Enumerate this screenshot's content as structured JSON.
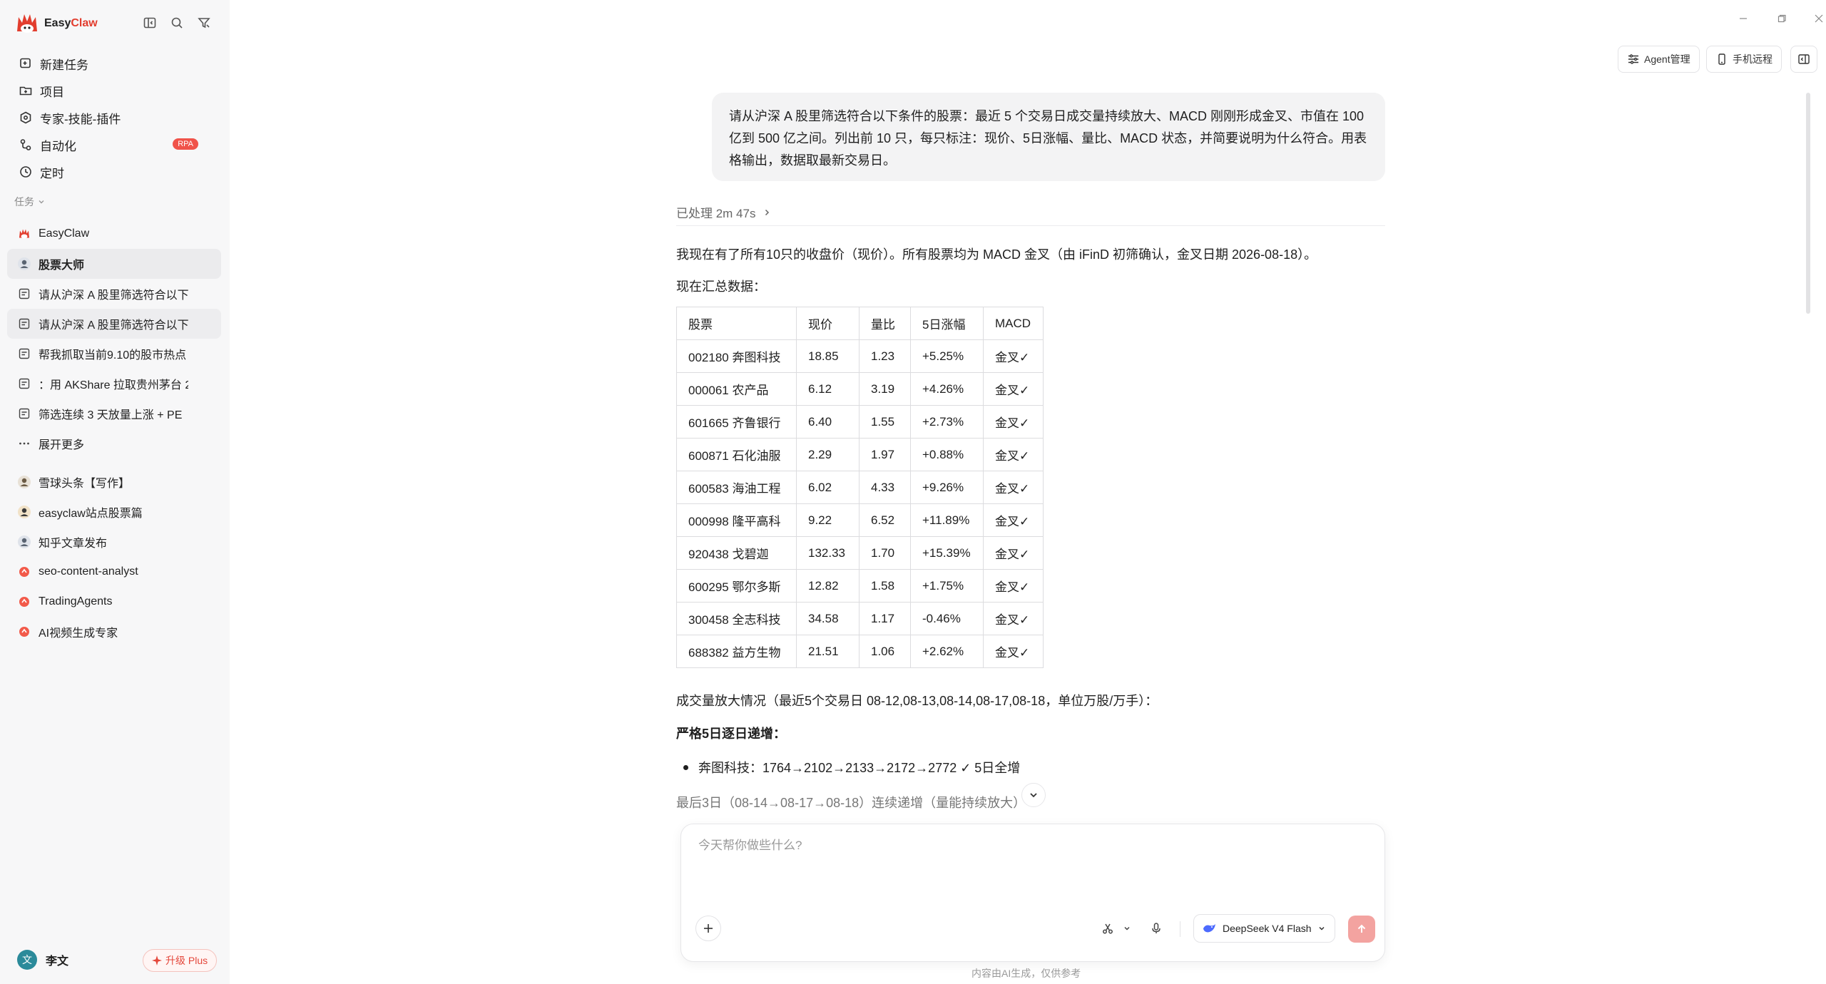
{
  "app": {
    "name_main": "Easy",
    "name_accent": "Claw"
  },
  "nav": [
    {
      "label": "新建任务",
      "icon": "new-task-icon"
    },
    {
      "label": "项目",
      "icon": "folder-icon"
    },
    {
      "label": "专家-技能-插件",
      "icon": "puzzle-icon"
    },
    {
      "label": "自动化",
      "icon": "automation-icon",
      "badge": "RPA"
    },
    {
      "label": "定时",
      "icon": "clock-icon"
    }
  ],
  "tasks_section_label": "任务",
  "tasks": [
    {
      "label": "EasyClaw",
      "icon": "easyclaw-logo-icon"
    },
    {
      "label": "股票大师",
      "icon": "avatar-icon",
      "active": true
    },
    {
      "label": "请从沪深 A 股里筛选符合以下",
      "icon": "chat-icon"
    },
    {
      "label": "请从沪深 A 股里筛选符合以下",
      "icon": "chat-icon",
      "hover": true
    },
    {
      "label": "帮我抓取当前9.10的股市热点",
      "icon": "chat-icon"
    },
    {
      "label": "：用 AKShare 拉取贵州茅台 2",
      "icon": "chat-icon"
    },
    {
      "label": "筛选连续 3 天放量上涨 + PE",
      "icon": "chat-icon"
    },
    {
      "label": "展开更多",
      "icon": "more-icon"
    }
  ],
  "agents": [
    {
      "label": "雪球头条【写作】",
      "icon": "avatar-icon"
    },
    {
      "label": "easyclaw站点股票篇",
      "icon": "avatar-icon"
    },
    {
      "label": "知乎文章发布",
      "icon": "avatar-icon"
    },
    {
      "label": "seo-content-analyst",
      "icon": "easyclaw-logo-icon"
    },
    {
      "label": "TradingAgents",
      "icon": "easyclaw-logo-icon"
    },
    {
      "label": "AI视频生成专家",
      "icon": "easyclaw-logo-icon"
    }
  ],
  "user": {
    "initial": "文",
    "name": "李文",
    "upgrade_label": "升级 Plus"
  },
  "header": {
    "agent_btn": "Agent管理",
    "phone_btn": "手机远程"
  },
  "chat": {
    "user_message": "请从沪深 A 股里筛选符合以下条件的股票：最近 5 个交易日成交量持续放大、MACD 刚刚形成金叉、市值在 100 亿到 500 亿之间。列出前 10 只，每只标注：现价、5日涨幅、量比、MACD 状态，并简要说明为什么符合。用表格输出，数据取最新交易日。",
    "processed": "已处理 2m 47s",
    "reply_p1": "我现在有了所有10只的收盘价（现价）。所有股票均为 MACD 金叉（由 iFinD 初筛确认，金叉日期 2026-08-18）。",
    "reply_p2": "现在汇总数据：",
    "table": {
      "headers": [
        "股票",
        "现价",
        "量比",
        "5日涨幅",
        "MACD"
      ],
      "rows": [
        [
          "002180 奔图科技",
          "18.85",
          "1.23",
          "+5.25%",
          "金叉✓"
        ],
        [
          "000061 农产品",
          "6.12",
          "3.19",
          "+4.26%",
          "金叉✓"
        ],
        [
          "601665 齐鲁银行",
          "6.40",
          "1.55",
          "+2.73%",
          "金叉✓"
        ],
        [
          "600871 石化油服",
          "2.29",
          "1.97",
          "+0.88%",
          "金叉✓"
        ],
        [
          "600583 海油工程",
          "6.02",
          "4.33",
          "+9.26%",
          "金叉✓"
        ],
        [
          "000998 隆平高科",
          "9.22",
          "6.52",
          "+11.89%",
          "金叉✓"
        ],
        [
          "920438 戈碧迦",
          "132.33",
          "1.70",
          "+15.39%",
          "金叉✓"
        ],
        [
          "600295 鄂尔多斯",
          "12.82",
          "1.58",
          "+1.75%",
          "金叉✓"
        ],
        [
          "300458 全志科技",
          "34.58",
          "1.17",
          "-0.46%",
          "金叉✓"
        ],
        [
          "688382 益方生物",
          "21.51",
          "1.06",
          "+2.62%",
          "金叉✓"
        ]
      ]
    },
    "reply_p3": "成交量放大情况（最近5个交易日 08-12,08-13,08-14,08-17,08-18，单位万股/万手）：",
    "reply_p4": "严格5日逐日递增：",
    "bullet1": "奔图科技：1764→2102→2133→2172→2772 ✓ 5日全增",
    "reply_p5": "最后3日（08-14→08-17→08-18）连续递增（量能持续放大）"
  },
  "composer": {
    "placeholder": "今天帮你做些什么?",
    "model": "DeepSeek V4 Flash",
    "disclaimer": "内容由AI生成，仅供参考"
  }
}
